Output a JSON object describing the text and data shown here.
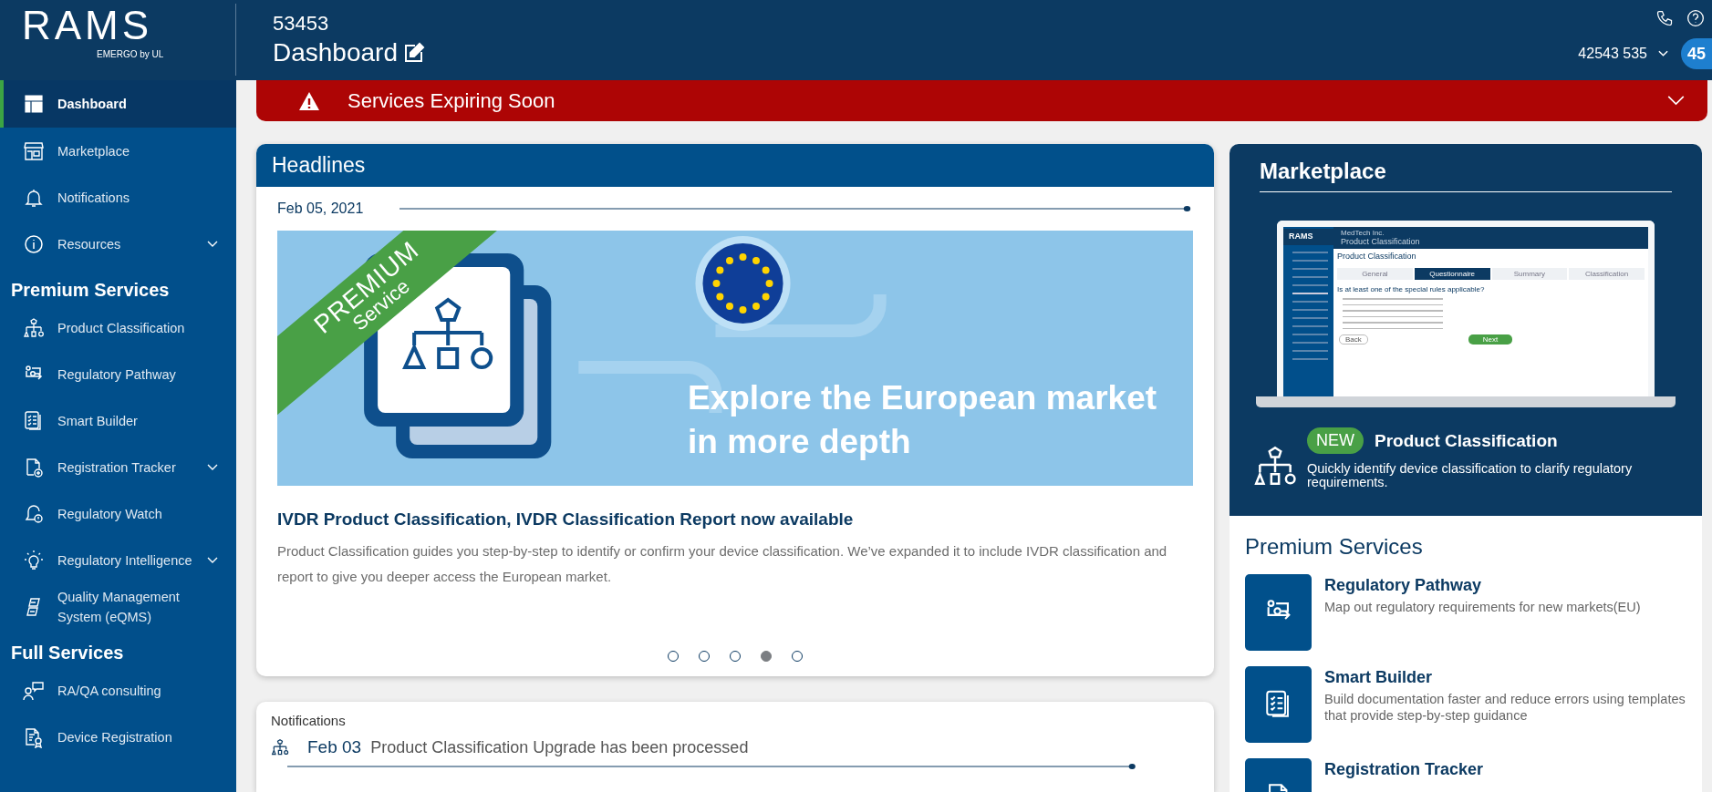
{
  "logo": {
    "name": "RAMS",
    "tagline": "EMERGO by UL"
  },
  "header": {
    "account_id": "53453",
    "page_title": "Dashboard",
    "user": "42543 535",
    "badge": "45"
  },
  "sidebar": {
    "items": [
      {
        "kind": "link",
        "label": "Dashboard",
        "selected": true,
        "expandable": false
      },
      {
        "kind": "link",
        "label": "Marketplace",
        "selected": false,
        "expandable": false
      },
      {
        "kind": "link",
        "label": "Notifications",
        "selected": false,
        "expandable": false
      },
      {
        "kind": "link",
        "label": "Resources",
        "selected": false,
        "expandable": true
      },
      {
        "kind": "heading",
        "label": "Premium Services"
      },
      {
        "kind": "link",
        "label": "Product Classification",
        "selected": false,
        "expandable": false
      },
      {
        "kind": "link",
        "label": "Regulatory Pathway",
        "selected": false,
        "expandable": false
      },
      {
        "kind": "link",
        "label": "Smart Builder",
        "selected": false,
        "expandable": false
      },
      {
        "kind": "link",
        "label": "Registration Tracker",
        "selected": false,
        "expandable": true
      },
      {
        "kind": "link",
        "label": "Regulatory Watch",
        "selected": false,
        "expandable": false
      },
      {
        "kind": "link",
        "label": "Regulatory Intelligence",
        "selected": false,
        "expandable": true
      },
      {
        "kind": "link",
        "label": "Quality Management System (eQMS)",
        "selected": false,
        "expandable": false
      },
      {
        "kind": "heading",
        "label": "Full Services"
      },
      {
        "kind": "link",
        "label": "RA/QA consulting",
        "selected": false,
        "expandable": false
      },
      {
        "kind": "link",
        "label": "Device Registration",
        "selected": false,
        "expandable": false
      }
    ]
  },
  "alert": {
    "text": "Services Expiring Soon"
  },
  "headlines": {
    "title": "Headlines",
    "date": "Feb 05, 2021",
    "banner": {
      "ribbon": "PREMIUM",
      "ribbon_sub": "Service",
      "text": "Explore the European market in more depth"
    },
    "article_title": "IVDR Product Classification, IVDR Classification Report now available",
    "article_text": "Product Classification guides you step-by-step to identify or confirm your device classification. We’ve expanded it to include IVDR classification and report to give you deeper access the European market.",
    "dots": [
      {
        "selected": false
      },
      {
        "selected": false
      },
      {
        "selected": false
      },
      {
        "selected": true
      },
      {
        "selected": false
      }
    ]
  },
  "notifications": {
    "title": "Notifications",
    "items": [
      {
        "date": "Feb 03",
        "text": "Product Classification Upgrade has been processed"
      }
    ]
  },
  "marketplace": {
    "title": "Marketplace",
    "preview": {
      "logo": "RAMS",
      "company": "MedTech Inc.",
      "header_title": "Product Classification",
      "page_title": "Product Classification",
      "steps": [
        {
          "label": "General",
          "selected": false
        },
        {
          "label": "Questionnaire",
          "selected": true
        },
        {
          "label": "Summary",
          "selected": false
        },
        {
          "label": "Classification",
          "selected": false
        }
      ],
      "question": "Is at least one of the special rules applicable?",
      "back": "Back",
      "next": "Next"
    },
    "badge": "NEW",
    "product": "Product Classification",
    "description": "Quickly identify device classification to clarify regulatory requirements."
  },
  "premium_services": {
    "title": "Premium Services",
    "items": [
      {
        "title": "Regulatory Pathway",
        "description": "Map out regulatory requirements for new markets(EU)"
      },
      {
        "title": "Smart Builder",
        "description": "Build documentation faster and reduce errors using templates that provide step-by-step guidance"
      },
      {
        "title": "Registration Tracker"
      }
    ]
  }
}
